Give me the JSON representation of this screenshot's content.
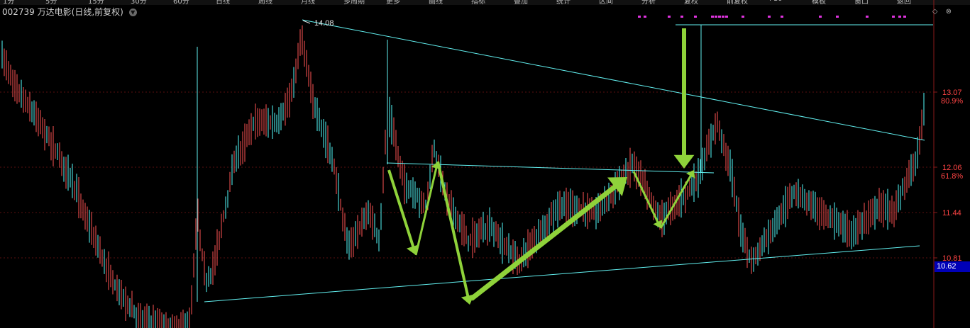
{
  "toolbar": {
    "items": [
      "1分",
      "5分",
      "15分",
      "30分",
      "60分",
      "日线",
      "周线",
      "月线",
      "多周期",
      "更多",
      "画线",
      "指标",
      "叠加",
      "统计",
      "区间",
      "分析",
      "复权",
      "前复权",
      "F10",
      "模板",
      "窗口",
      "返回"
    ]
  },
  "header": {
    "code": "002739",
    "name": "万达电影",
    "mode": "(日线,前复权)",
    "dropdown_icon": "chevron-down-icon"
  },
  "corner": {
    "diamond_icon": "diamond-icon",
    "close_icon": "close-circle-icon"
  },
  "axis": {
    "levels": [
      {
        "price": "13.07",
        "pct": "80.9%"
      },
      {
        "price": "12.06",
        "pct": "61.8%"
      },
      {
        "price": "11.44",
        "pct": ""
      },
      {
        "price": "10.81",
        "pct": ""
      }
    ],
    "current_price": "10.62"
  },
  "high_marker": "14.08",
  "colors": {
    "background": "#000000",
    "up_candle": "#ff5555",
    "down_candle": "#54fcfc",
    "trend_line": "#62f0f0",
    "annotation_arrow": "#8fd23a",
    "signal_marker": "#dd33dd",
    "axis_text": "#ff4444",
    "current_price_bg": "#0000b8"
  }
}
